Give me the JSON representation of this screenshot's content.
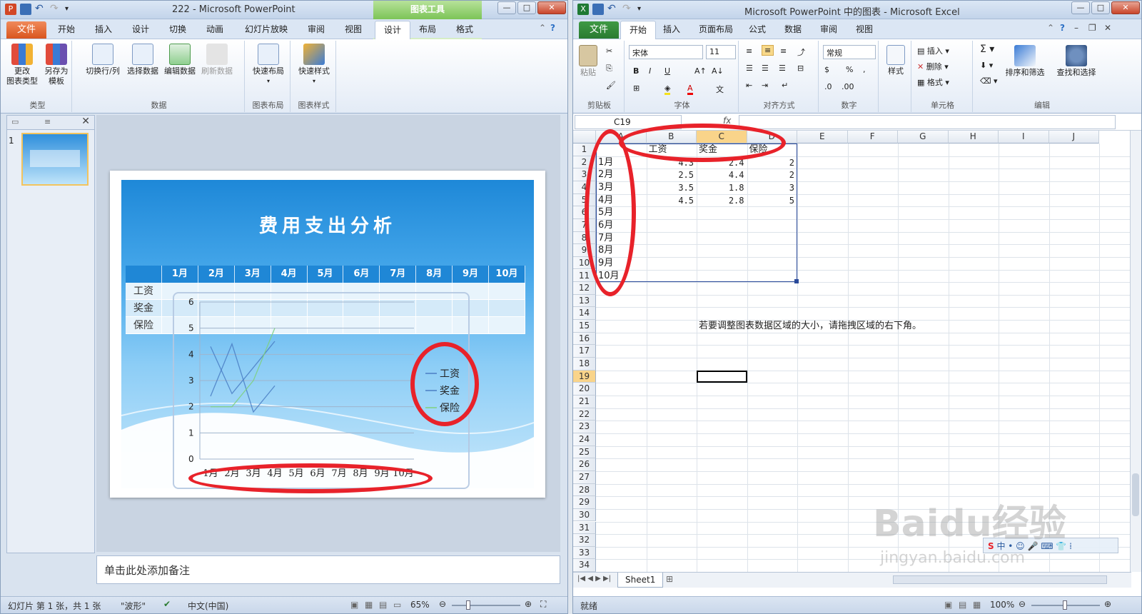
{
  "ppt": {
    "title": "222  -  Microsoft PowerPoint",
    "context_tab_header": "图表工具",
    "file_tab": "文件",
    "tabs": [
      "开始",
      "插入",
      "设计",
      "切换",
      "动画",
      "幻灯片放映",
      "审阅",
      "视图",
      "设计",
      "布局",
      "格式"
    ],
    "ribbon": {
      "btn_change_type": "更改\n图表类型",
      "btn_save_template": "另存为\n模板",
      "grp_type": "类型",
      "btn_switch": "切换行/列",
      "btn_select_data": "选择数据",
      "btn_edit_data": "编辑数据",
      "btn_refresh_data": "刷新数据",
      "grp_data": "数据",
      "btn_quick_layout": "快速布局",
      "grp_layout": "图表布局",
      "btn_quick_style": "快速样式",
      "grp_style": "图表样式"
    },
    "slide": {
      "title": "费用支出分析",
      "months": [
        "1月",
        "2月",
        "3月",
        "4月",
        "5月",
        "6月",
        "7月",
        "8月",
        "9月",
        "10月"
      ],
      "rows": [
        "工资",
        "奖金",
        "保险"
      ]
    },
    "notes_placeholder": "单击此处添加备注",
    "status": {
      "slide_info": "幻灯片 第 1 张，共 1 张",
      "theme": "\"波形\"",
      "lang": "中文(中国)",
      "zoom": "65%"
    },
    "thumb_number": "1"
  },
  "chart_data": {
    "type": "line",
    "categories": [
      "1月",
      "2月",
      "3月",
      "4月",
      "5月",
      "6月",
      "7月",
      "8月",
      "9月",
      "10月"
    ],
    "series": [
      {
        "name": "工资",
        "values": [
          4.3,
          2.5,
          3.5,
          4.5,
          null,
          null,
          null,
          null,
          null,
          null
        ],
        "color": "#4a7ec4"
      },
      {
        "name": "奖金",
        "values": [
          2.4,
          4.4,
          1.8,
          2.8,
          null,
          null,
          null,
          null,
          null,
          null
        ],
        "color": "#4a7ec4"
      },
      {
        "name": "保险",
        "values": [
          2,
          2,
          3,
          5,
          null,
          null,
          null,
          null,
          null,
          null
        ],
        "color": "#7ed07e"
      }
    ],
    "ylim": [
      0,
      6
    ],
    "yticks": [
      "0",
      "1",
      "2",
      "3",
      "4",
      "5",
      "6"
    ],
    "legend": "right",
    "grid": true
  },
  "excel": {
    "title": "Microsoft PowerPoint 中的图表  -  Microsoft Excel",
    "file_tab": "文件",
    "tabs": [
      "开始",
      "插入",
      "页面布局",
      "公式",
      "数据",
      "审阅",
      "视图"
    ],
    "ribbon": {
      "paste": "粘贴",
      "grp_clipboard": "剪贴板",
      "font_name": "宋体",
      "font_size": "11",
      "grp_font": "字体",
      "grp_align": "对齐方式",
      "num_format": "常规",
      "grp_number": "数字",
      "btn_style": "样式",
      "btn_insert": "插入",
      "btn_delete": "删除",
      "btn_format": "格式",
      "grp_cells": "单元格",
      "btn_sort": "排序和筛选",
      "btn_find": "查找和选择",
      "grp_edit": "编辑"
    },
    "namebox": "C19",
    "fx": "fx",
    "columns": [
      "A",
      "B",
      "C",
      "D",
      "E",
      "F",
      "G",
      "H",
      "I",
      "J"
    ],
    "rows": [
      "1",
      "2",
      "3",
      "4",
      "5",
      "6",
      "7",
      "8",
      "9",
      "10",
      "11",
      "12",
      "13",
      "14",
      "15",
      "16",
      "17",
      "18",
      "19",
      "20",
      "21",
      "22",
      "23",
      "24",
      "25",
      "26",
      "27",
      "28",
      "29",
      "30",
      "31",
      "32",
      "33",
      "34"
    ],
    "header_row": [
      "工资",
      "奖金",
      "保险"
    ],
    "data_labels": [
      "1月",
      "2月",
      "3月",
      "4月",
      "5月",
      "6月",
      "7月",
      "8月",
      "9月",
      "10月"
    ],
    "data_values": [
      [
        "4.3",
        "2.4",
        "2"
      ],
      [
        "2.5",
        "4.4",
        "2"
      ],
      [
        "3.5",
        "1.8",
        "3"
      ],
      [
        "4.5",
        "2.8",
        "5"
      ]
    ],
    "hint": "若要调整图表数据区域的大小，请拖拽区域的右下角。",
    "sheet_tab": "Sheet1",
    "status_ready": "就绪",
    "zoom": "100%"
  },
  "watermark": "Baidu经验",
  "watermark_url": "jingyan.baidu.com"
}
